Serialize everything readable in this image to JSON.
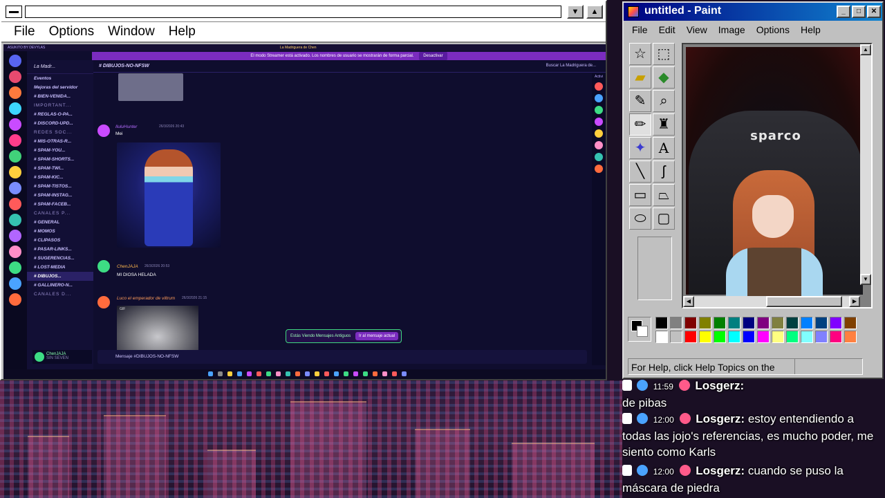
{
  "host_window": {
    "menu": [
      "File",
      "Options",
      "Window",
      "Help"
    ],
    "min_glyph": "▼",
    "max_glyph": "▲"
  },
  "discord": {
    "top_label": "ASUKITO BY DEVYLAS",
    "window_title": "La Madriguera de Chen",
    "streamer_banner": "El modo Streamer está activado. Los nombres de usuario se mostrarán de forma parcial.",
    "streamer_button": "Desactivar",
    "guild_name": "La Madr...",
    "channel_title": "DIBUJOS-NO-NFSW",
    "search_placeholder": "Buscar La Madriguera de...",
    "channels": [
      {
        "label": "Eventos",
        "type": "item"
      },
      {
        "label": "Mejoras del servidor",
        "type": "item"
      },
      {
        "label": "# BIEN-VENIDA...",
        "type": "channel"
      },
      {
        "label": "IMPORTANT...",
        "type": "category"
      },
      {
        "label": "# REGLAS-O-PA...",
        "type": "channel"
      },
      {
        "label": "# DISCORD-UPD...",
        "type": "channel"
      },
      {
        "label": "REDES SOC...",
        "type": "category"
      },
      {
        "label": "# MIS-OTRAS-R...",
        "type": "channel"
      },
      {
        "label": "# SPAM-YOU...",
        "type": "channel"
      },
      {
        "label": "# SPAM-SHORTS...",
        "type": "channel"
      },
      {
        "label": "# SPAM-TWI...",
        "type": "channel"
      },
      {
        "label": "# SPAM-KIC...",
        "type": "channel"
      },
      {
        "label": "# SPAM-TISTOS...",
        "type": "channel"
      },
      {
        "label": "# SPAM-INSTAG...",
        "type": "channel"
      },
      {
        "label": "# SPAM-FACEB...",
        "type": "channel"
      },
      {
        "label": "CANALES P...",
        "type": "category"
      },
      {
        "label": "# GENERAL",
        "type": "channel"
      },
      {
        "label": "# MOMOS",
        "type": "channel"
      },
      {
        "label": "# CLIPASOS",
        "type": "channel"
      },
      {
        "label": "# PASAR-LINKS...",
        "type": "channel"
      },
      {
        "label": "# SUGERENCIAS...",
        "type": "channel"
      },
      {
        "label": "# LOST-MEDIA",
        "type": "channel"
      },
      {
        "label": "# DIBUJOS...",
        "type": "selected"
      },
      {
        "label": "# GALLINERO-N...",
        "type": "channel"
      },
      {
        "label": "CANALES D...",
        "type": "category"
      }
    ],
    "user_name": "ChenJAJA",
    "user_status": "SIN SEVEN",
    "messages": [
      {
        "author": "IluluHunter",
        "time": "26/3/2026 20:43",
        "text": "Mei"
      },
      {
        "author": "ChenJAJA",
        "time": "26/3/2026 20:53",
        "text": "MI DIOSA HELADA"
      },
      {
        "author": "Luco el emperador de viltrum",
        "time": "26/3/2026 21:15",
        "text": "GIF"
      }
    ],
    "old_messages_notice": "Estás Viendo Mensajes Antiguos",
    "old_messages_button": "Ir al mensaje actual",
    "input_placeholder": "Mensaje #DIBUJOS-NO-NFSW",
    "activity_label": "Activi"
  },
  "paint": {
    "title": "untitled - Paint",
    "menu": [
      "File",
      "Edit",
      "View",
      "Image",
      "Options",
      "Help"
    ],
    "tools": [
      "free-select",
      "select",
      "eraser",
      "fill",
      "color-picker",
      "magnifier",
      "pencil",
      "brush",
      "airbrush",
      "text",
      "line",
      "curve",
      "rectangle",
      "polygon",
      "ellipse",
      "rounded-rectangle"
    ],
    "selected_tool": "pencil",
    "canvas_logo": "sparco",
    "status_text": "For Help, click Help Topics on the",
    "palette": [
      "#000000",
      "#808080",
      "#800000",
      "#808000",
      "#008000",
      "#008080",
      "#000080",
      "#800080",
      "#808040",
      "#004040",
      "#0080ff",
      "#004080",
      "#8000ff",
      "#804000",
      "#ffffff",
      "#c0c0c0",
      "#ff0000",
      "#ffff00",
      "#00ff00",
      "#00ffff",
      "#0000ff",
      "#ff00ff",
      "#ffff80",
      "#00ff80",
      "#80ffff",
      "#8080ff",
      "#ff0080",
      "#ff8040"
    ]
  },
  "chat": [
    {
      "time": "11:59",
      "user": "Losgerz",
      "text": "de pibas"
    },
    {
      "time": "12:00",
      "user": "Losgerz",
      "text": "estoy entendiendo a todas las jojo's referencias, es mucho poder, me siento como Karls"
    },
    {
      "time": "12:00",
      "user": "Losgerz",
      "text": "cuando se puso la máscara de piedra"
    }
  ]
}
